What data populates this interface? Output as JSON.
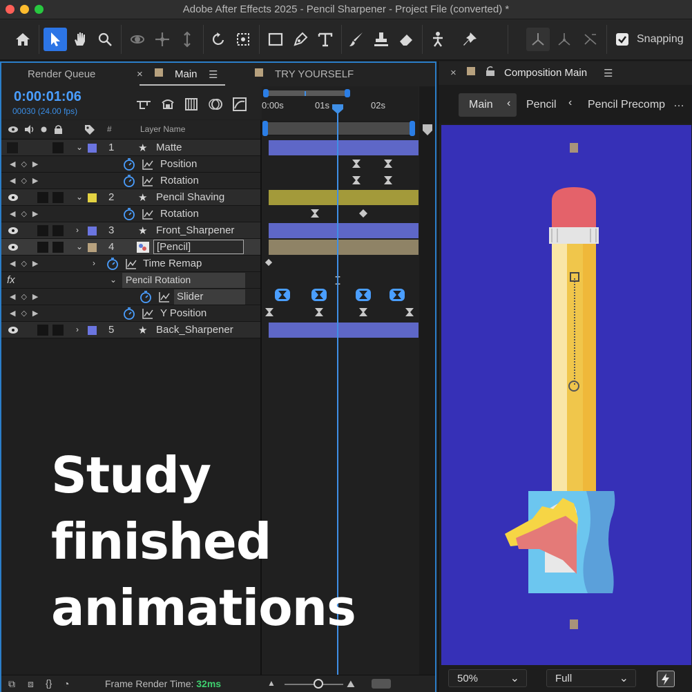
{
  "window": {
    "title": "Adobe After Effects 2025 - Pencil Sharpener - Project File (converted) *"
  },
  "toolbar": {
    "tools": [
      "home-icon",
      "selection-tool-icon",
      "hand-tool-icon",
      "zoom-tool-icon",
      "orbit-camera-icon",
      "pan-camera-icon",
      "dolly-camera-icon",
      "rotate-tool-icon",
      "pan-behind-icon",
      "rectangle-tool-icon",
      "pen-tool-icon",
      "type-tool-icon",
      "brush-tool-icon",
      "clone-stamp-icon",
      "eraser-tool-icon",
      "roto-brush-icon",
      "puppet-pin-icon"
    ],
    "snapping_label": "Snapping",
    "snapping_checked": true
  },
  "left_tabs": {
    "render_queue": "Render Queue",
    "main": "Main",
    "try_yourself": "TRY YOURSELF"
  },
  "timeline": {
    "timecode": "0:00:01:06",
    "frames": "00030 (24.00 fps)",
    "ruler": [
      "0:00s",
      "01s",
      "02s"
    ],
    "col_num": "#",
    "col_layer_name": "Layer Name"
  },
  "layers": [
    {
      "num": "1",
      "name": "Matte",
      "color": "#6b75e0"
    },
    {
      "prop": "Position"
    },
    {
      "prop": "Rotation"
    },
    {
      "num": "2",
      "name": "Pencil Shaving",
      "color": "#e4d342"
    },
    {
      "prop": "Rotation"
    },
    {
      "num": "3",
      "name": "Front_Sharpener",
      "color": "#6b75e0"
    },
    {
      "num": "4",
      "name": "[Pencil]",
      "color": "#b7a17e"
    },
    {
      "prop": "Time Remap"
    },
    {
      "fx": "fx",
      "effect": "Pencil Rotation"
    },
    {
      "prop": "Slider"
    },
    {
      "prop": "Y Position"
    },
    {
      "num": "5",
      "name": "Back_Sharpener",
      "color": "#6b75e0"
    }
  ],
  "status": {
    "frame_render_label": "Frame Render Time:",
    "frame_render_value": "32ms"
  },
  "composition": {
    "tab_label": "Composition Main",
    "crumbs": [
      "Main",
      "Pencil",
      "Pencil Precomp"
    ],
    "zoom": "50%",
    "resolution": "Full",
    "bg_color": "#3630b7"
  },
  "overlay_text": [
    "Study",
    "finished",
    "animations"
  ]
}
